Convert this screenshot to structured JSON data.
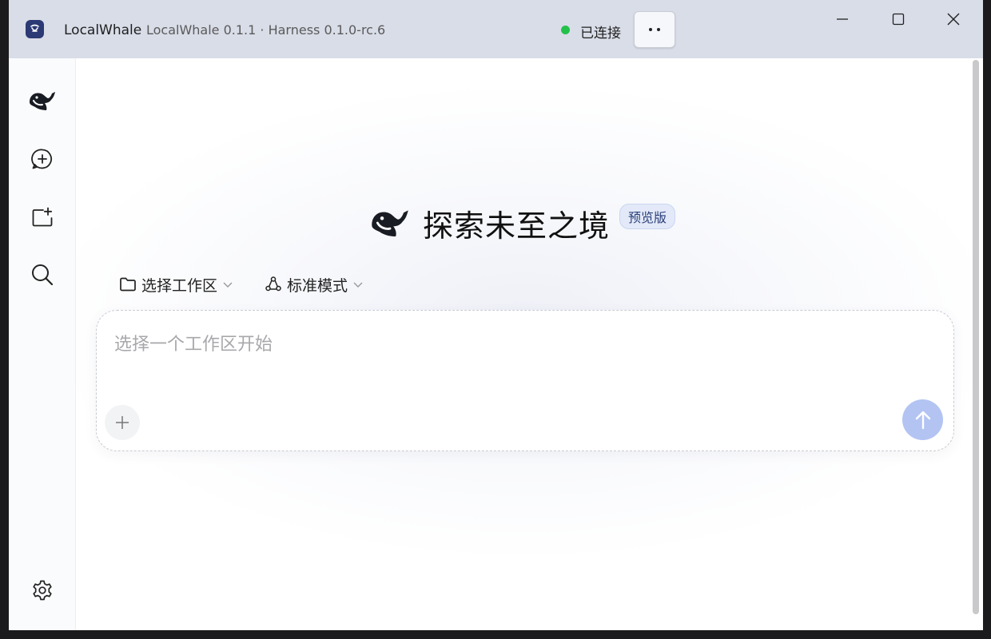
{
  "titlebar": {
    "app_name": "LocalWhale",
    "version": "LocalWhale 0.1.1 · Harness 0.1.0-rc.6",
    "status_text": "已连接",
    "status_color": "#22c14a"
  },
  "sidebar": {
    "items": [
      {
        "icon": "whale-logo-icon"
      },
      {
        "icon": "new-chat-icon"
      },
      {
        "icon": "new-folder-icon"
      },
      {
        "icon": "search-icon"
      }
    ],
    "bottom": {
      "icon": "gear-icon"
    }
  },
  "hero": {
    "title": "探索未至之境",
    "badge": "预览版"
  },
  "controls": {
    "workspace_label": "选择工作区",
    "mode_label": "标准模式"
  },
  "composer": {
    "placeholder": "选择一个工作区开始"
  },
  "colors": {
    "accent": "#b3c4f3",
    "titlebar": "#d9dde8",
    "badge_bg": "#e3e9f8"
  }
}
